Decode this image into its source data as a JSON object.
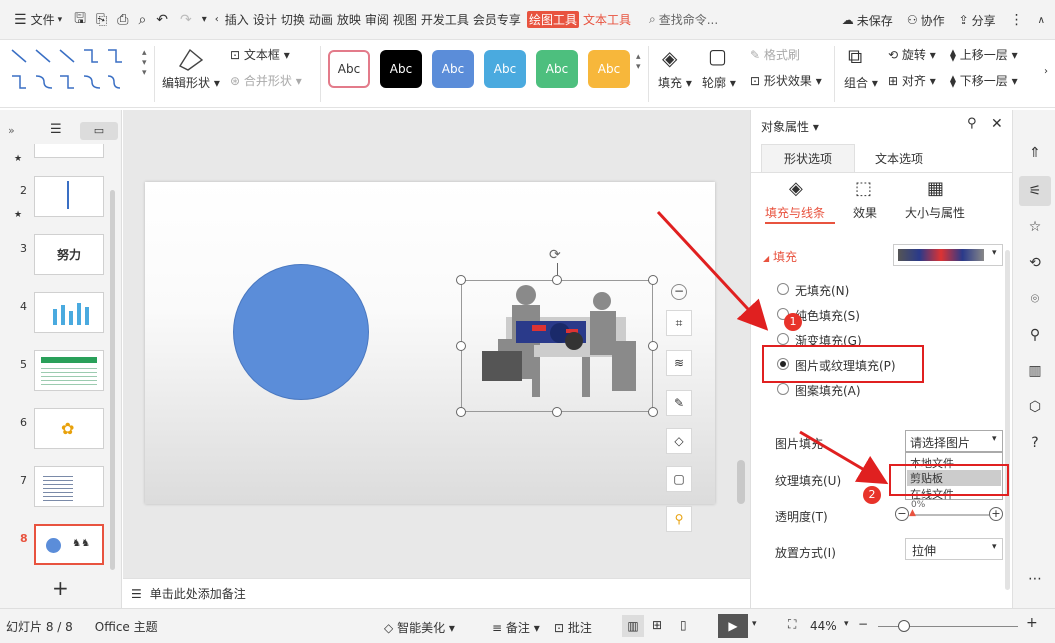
{
  "titlebar": {
    "file_menu": "文件",
    "menu_tabs": [
      "插入",
      "设计",
      "切换",
      "动画",
      "放映",
      "审阅",
      "视图",
      "开发工具",
      "会员专享"
    ],
    "draw_tools_tab": "绘图工具",
    "text_tools_tab": "文本工具",
    "search_placeholder": "查找命令...",
    "unsaved": "未保存",
    "collaborate": "协作",
    "share": "分享"
  },
  "ribbon": {
    "edit_shape": "编辑形状",
    "textbox": "文本框",
    "merge_shape": "合并形状",
    "style_label": "Abc",
    "style_colors": [
      "#ffffff",
      "#000000",
      "#5b8dd9",
      "#4aaadf",
      "#4dbf7e",
      "#f7b73b"
    ],
    "fill": "填充",
    "outline": "轮廓",
    "format_painter": "格式刷",
    "shape_effect": "形状效果",
    "group": "组合",
    "rotate": "旋转",
    "align": "对齐",
    "bring_forward": "上移一层",
    "send_backward": "下移一层"
  },
  "thumbs": {
    "numbers": [
      "2",
      "3",
      "4",
      "5",
      "6",
      "7",
      "8"
    ],
    "slide3_text": "努力"
  },
  "notes_placeholder": "单击此处添加备注",
  "panel": {
    "title": "对象属性",
    "tab_shape": "形状选项",
    "tab_text": "文本选项",
    "sub_fill_line": "填充与线条",
    "sub_effect": "效果",
    "sub_size": "大小与属性",
    "fill_section": "填充",
    "opt_none": "无填充(N)",
    "opt_solid": "纯色填充(S)",
    "opt_gradient": "渐变填充(G)",
    "opt_picture": "图片或纹理填充(P)",
    "opt_pattern": "图案填充(A)",
    "picture_fill_label": "图片填充",
    "picture_select": "请选择图片",
    "dd_local": "本地文件",
    "dd_clipboard": "剪贴板",
    "dd_online": "在线文件",
    "texture_label": "纹理填充(U)",
    "transparency_label": "透明度(T)",
    "transparency_value": "0%",
    "placement_label": "放置方式(I)",
    "placement_value": "拉伸"
  },
  "annotations": {
    "badge1": "1",
    "badge2": "2"
  },
  "statusbar": {
    "slide_info": "幻灯片 8 / 8",
    "theme": "Office 主题",
    "beautify": "智能美化",
    "notes": "备注",
    "comment": "批注",
    "zoom": "44%"
  },
  "colors": {
    "accent": "#e8533f",
    "circle": "#5b8dd9",
    "annotation_red": "#e02020"
  }
}
